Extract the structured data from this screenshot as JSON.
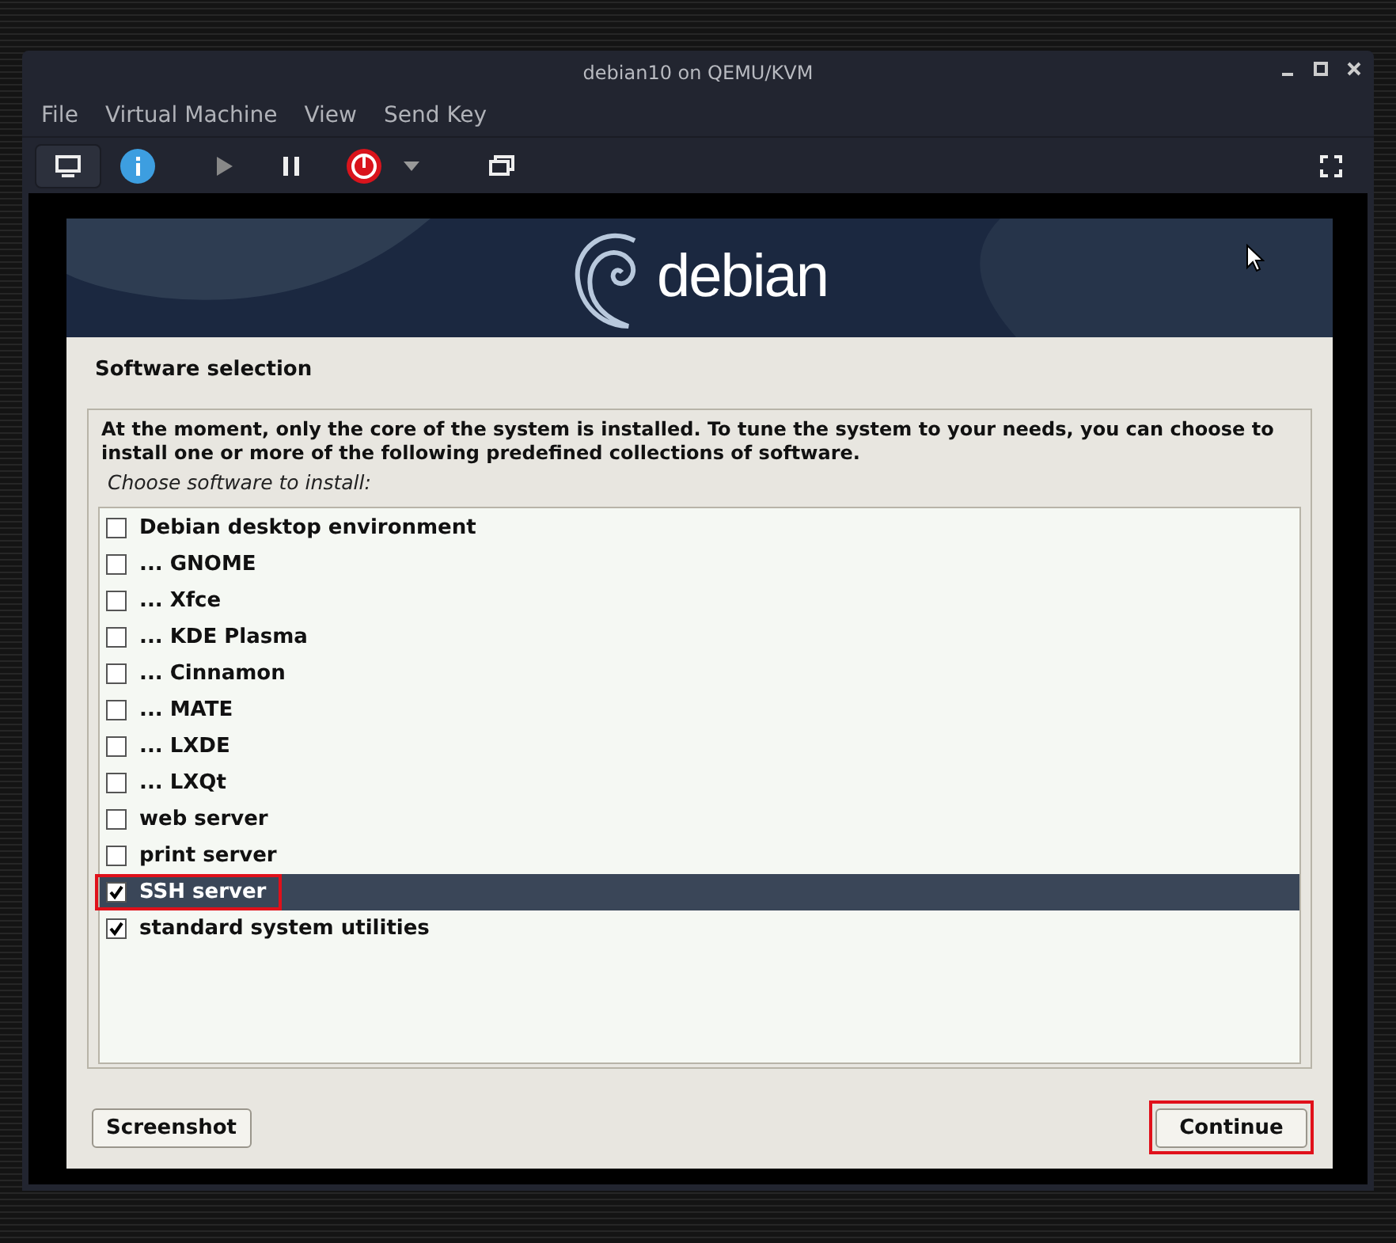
{
  "window": {
    "title": "debian10 on QEMU/KVM"
  },
  "menu": [
    "File",
    "Virtual Machine",
    "View",
    "Send Key"
  ],
  "installer": {
    "logo_text": "debian",
    "heading": "Software selection",
    "intro": "At the moment, only the core of the system is installed. To tune the system to your needs, you can choose to install one or more of the following predefined collections of software.",
    "prompt": "Choose software to install:",
    "items": [
      {
        "label": "Debian desktop environment",
        "checked": false,
        "selected": false,
        "highlighted": false
      },
      {
        "label": "... GNOME",
        "checked": false,
        "selected": false,
        "highlighted": false
      },
      {
        "label": "... Xfce",
        "checked": false,
        "selected": false,
        "highlighted": false
      },
      {
        "label": "... KDE Plasma",
        "checked": false,
        "selected": false,
        "highlighted": false
      },
      {
        "label": "... Cinnamon",
        "checked": false,
        "selected": false,
        "highlighted": false
      },
      {
        "label": "... MATE",
        "checked": false,
        "selected": false,
        "highlighted": false
      },
      {
        "label": "... LXDE",
        "checked": false,
        "selected": false,
        "highlighted": false
      },
      {
        "label": "... LXQt",
        "checked": false,
        "selected": false,
        "highlighted": false
      },
      {
        "label": "web server",
        "checked": false,
        "selected": false,
        "highlighted": false
      },
      {
        "label": "print server",
        "checked": false,
        "selected": false,
        "highlighted": false
      },
      {
        "label": "SSH server",
        "checked": true,
        "selected": true,
        "highlighted": true
      },
      {
        "label": "standard system utilities",
        "checked": true,
        "selected": false,
        "highlighted": false
      }
    ],
    "buttons": [
      {
        "label": "Screenshot",
        "highlighted": false
      },
      {
        "label": "Continue",
        "highlighted": true
      }
    ]
  }
}
